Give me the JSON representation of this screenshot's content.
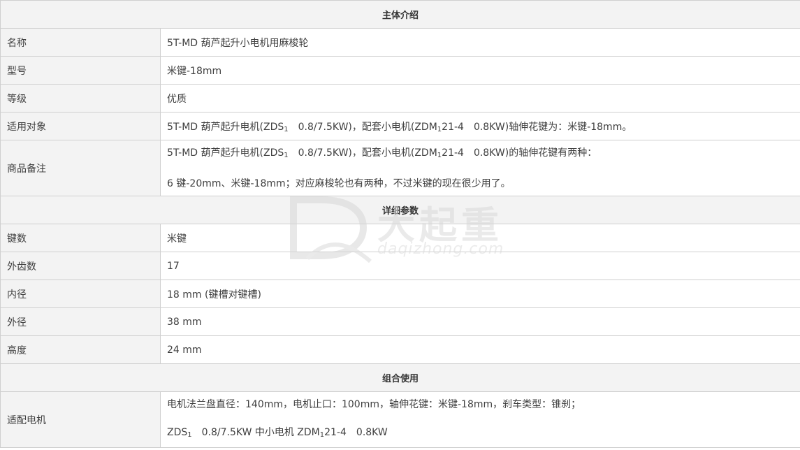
{
  "sections": {
    "intro": "主体介绍",
    "detail": "详细参数",
    "combo": "组合使用"
  },
  "intro_rows": {
    "name": {
      "label": "名称",
      "value": "5T-MD 葫芦起升小电机用麻梭轮"
    },
    "model": {
      "label": "型号",
      "value": "米键-18mm"
    },
    "grade": {
      "label": "等级",
      "value": "优质"
    },
    "applicable": {
      "label": "适用对象",
      "v1": "5T-MD 葫芦起升电机(ZDS",
      "v2": "1",
      "v3": "0.8/7.5KW)，配套小电机(ZDM",
      "v4": "1",
      "v5": "21-4　0.8KW)轴伸花键为：米键-18mm。"
    },
    "remark": {
      "label": "商品备注",
      "l1a": "5T-MD 葫芦起升电机(ZDS",
      "l1b": "1",
      "l1c": "　0.8/7.5KW)，配套小电机(ZDM",
      "l1d": "1",
      "l1e": "21-4　0.8KW)的轴伸花键有两种：",
      "l2": "6 键-20mm、米键-18mm；对应麻梭轮也有两种，不过米键的现在很少用了。"
    }
  },
  "detail_rows": {
    "keys": {
      "label": "键数",
      "value": "米键"
    },
    "teeth": {
      "label": "外齿数",
      "value": "17"
    },
    "inner": {
      "label": "内径",
      "value": "18 mm (键槽对键槽)"
    },
    "outer": {
      "label": "外径",
      "value": "38 mm"
    },
    "height": {
      "label": "高度",
      "value": "24 mm"
    }
  },
  "combo_rows": {
    "motor": {
      "label": "适配电机",
      "l1": "电机法兰盘直径：140mm，电机止口：100mm，轴伸花键：米键-18mm，刹车类型：锥刹；",
      "l2a": "ZDS",
      "l2b": "1",
      "l2c": "0.8/7.5KW  中小电机 ZDM",
      "l2d": "1",
      "l2e": "21-4　0.8KW"
    }
  },
  "watermark": {
    "cn": "大起重",
    "en": "daqizhong.com",
    "icon": "dq-logo-icon"
  }
}
